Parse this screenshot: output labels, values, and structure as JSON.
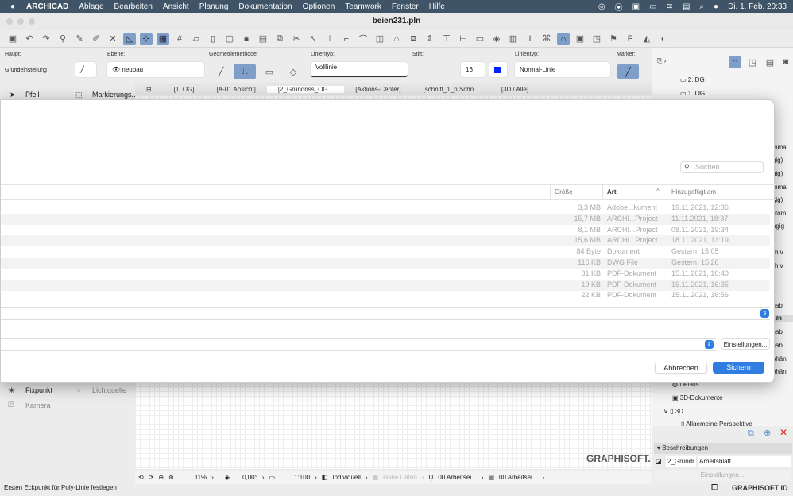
{
  "menubar": {
    "apple": "",
    "app": "ARCHICAD",
    "items": [
      "Ablage",
      "Bearbeiten",
      "Ansicht",
      "Planung",
      "Dokumentation",
      "Optionen",
      "Teamwork",
      "Fenster",
      "Hilfe"
    ],
    "clock": "Di. 1. Feb.  20:33"
  },
  "window": {
    "title": "beien231.pln"
  },
  "infobox": {
    "haupt_label": "Haupt:",
    "haupt_value": "Grundeinstellung",
    "ebene_label": "Ebene:",
    "ebene_value": "neubau",
    "geom_label": "Geometriemethode:",
    "linientyp_label": "Linientyp:",
    "linientyp_value": "Volllinie",
    "stift_label": "Stift:",
    "stift_value": "16",
    "linientyp2_label": "Linientyp:",
    "linientyp2_value": "Normal-Linie",
    "marker_label": "Marker:"
  },
  "tabs": [
    "[1. OG]",
    "[A-01 Ansicht]",
    "[2_Grundriss_OG...",
    "[Aktions-Center]",
    "[schnitt_1_h Schn...",
    "[3D / Alle]"
  ],
  "toolbox": {
    "top": [
      "Pfeil",
      "Markierungs..."
    ],
    "bottom": [
      "Fixpunkt",
      "Lichtquelle",
      "Kamera"
    ]
  },
  "navigator": {
    "top": [
      "2. DG",
      "1. OG"
    ],
    "bottom": [
      "Details",
      "3D-Dokumente",
      "3D",
      "Allgemeine Perspektive"
    ],
    "fragments": [
      "automa",
      "ängig)",
      "ängig)",
      "automa",
      "ängig)",
      "l autom",
      "hängig",
      "tisch v",
      "tisch v",
      "(Unab",
      "tt (Un",
      "(Unab",
      "(Unab",
      "nabhän",
      "nabhän"
    ],
    "beschreibungen": "Beschreibungen",
    "name_value": "2_Grundr",
    "type_value": "Arbeitsblatt",
    "settings_button": "Einstellungen...",
    "logo": "GRAPHISOFT.",
    "graphisoft_id": "GRAPHISOFT ID"
  },
  "dialog": {
    "search_placeholder": "Suchen",
    "columns": {
      "size": "Größe",
      "kind": "Art",
      "added": "Hinzugefügt am"
    },
    "rows": [
      {
        "size": "3,3 MB",
        "kind": "Adobe...kument",
        "added": "19.11.2021, 12:36"
      },
      {
        "size": "15,7 MB",
        "kind": "ARCHI...Project",
        "added": "11.11.2021, 18:37"
      },
      {
        "size": "8,1 MB",
        "kind": "ARCHI...Project",
        "added": "08.11.2021, 19:34"
      },
      {
        "size": "15,6 MB",
        "kind": "ARCHI...Project",
        "added": "18.11.2021, 13:19"
      },
      {
        "size": "84 Byte",
        "kind": "Dokument",
        "added": "Gestern, 15:05"
      },
      {
        "size": "116 KB",
        "kind": "DWG File",
        "added": "Gestern, 15:26"
      },
      {
        "size": "31 KB",
        "kind": "PDF-Dokument",
        "added": "15.11.2021, 16:40"
      },
      {
        "size": "19 KB",
        "kind": "PDF-Dokument",
        "added": "15.11.2021, 16:35"
      },
      {
        "size": "22 KB",
        "kind": "PDF-Dokument",
        "added": "15.11.2021, 16:56"
      }
    ],
    "settings_button": "Einstellungen...",
    "cancel_button": "Abbrechen",
    "save_button": "Sichern",
    "accent": "#2f7de1"
  },
  "footer": {
    "zoom": "11%",
    "angle": "0,00°",
    "scale": "1:100",
    "layer_combo": "Individuell",
    "no_data": "keine Daten",
    "pen_set": "00 Arbeitsei...",
    "model_view": "00 Arbeitsei..."
  },
  "status": "Ersten Eckpunkt für Poly-Linie festlegen"
}
